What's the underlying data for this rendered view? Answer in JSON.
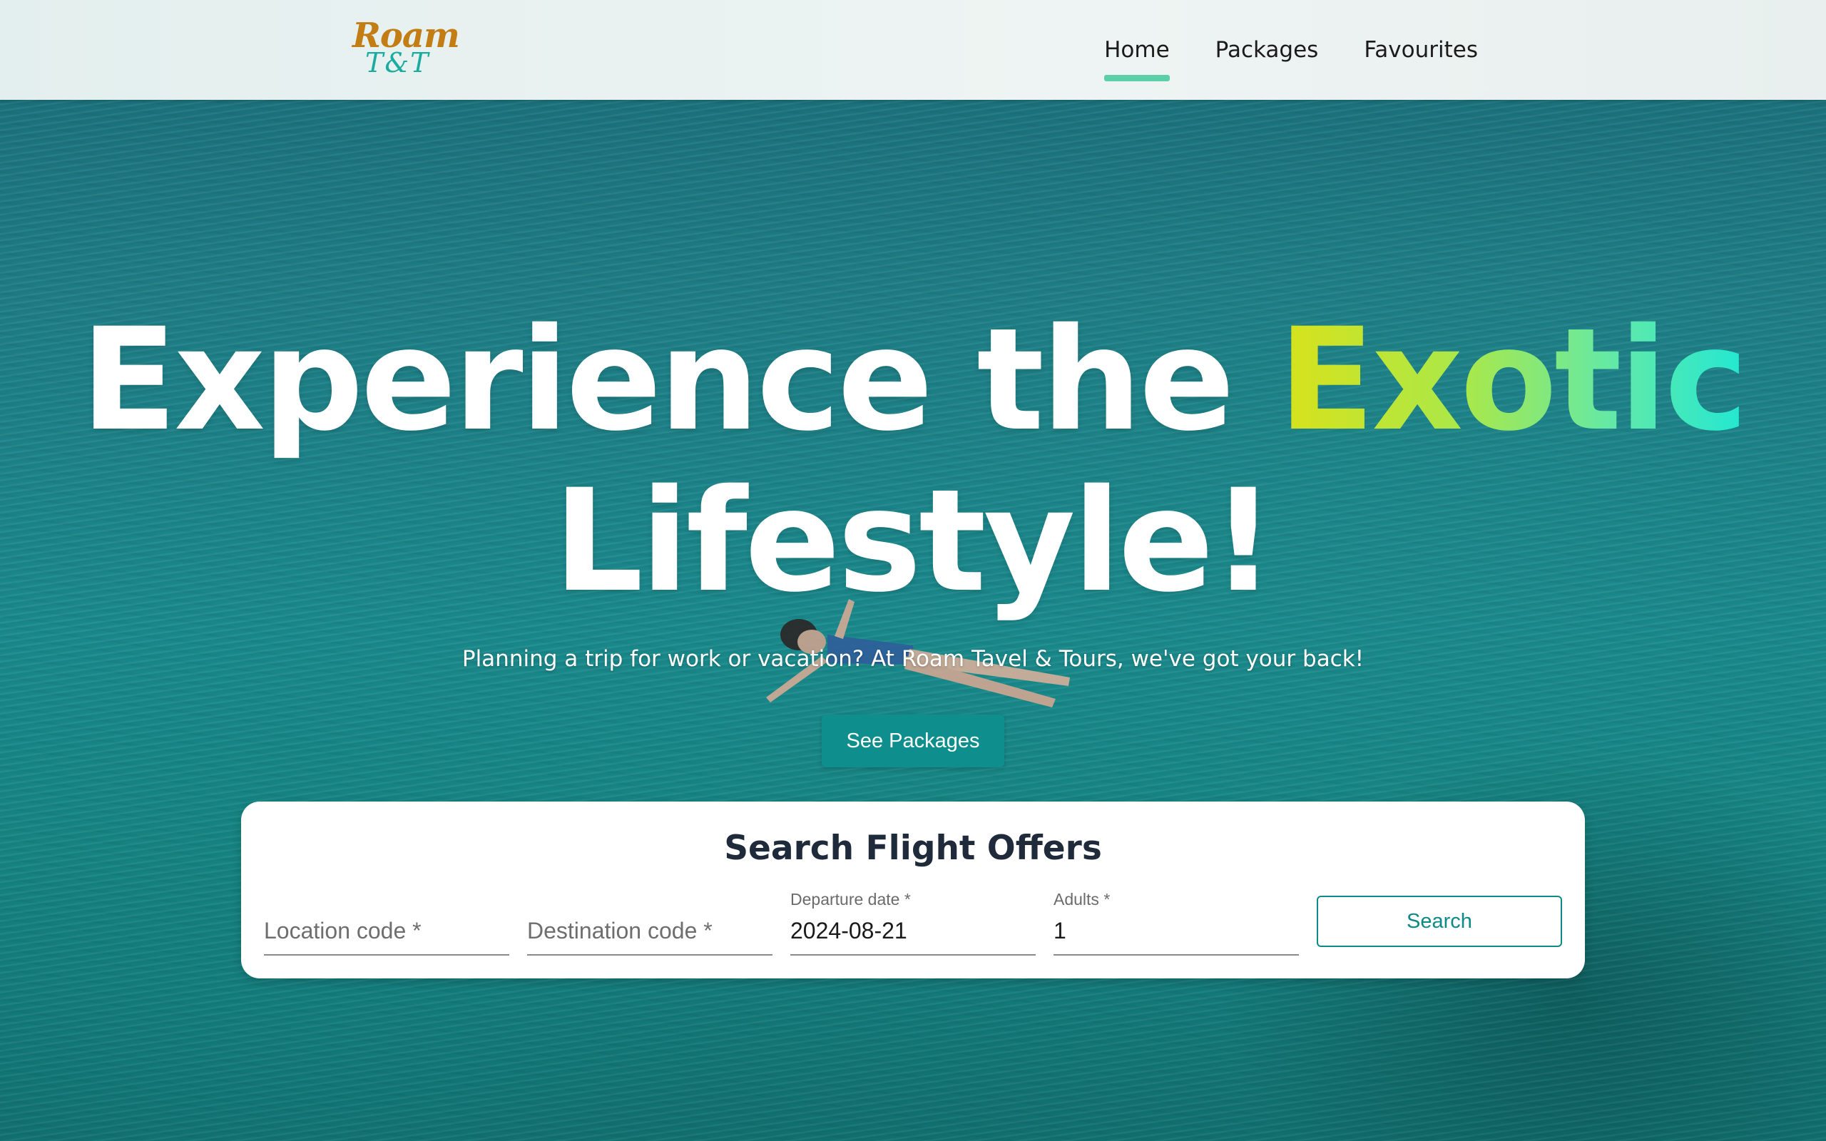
{
  "colors": {
    "accent": "#0e8e8c",
    "nav_underline": "#5ccfa9",
    "logo_primary": "#c27d15",
    "logo_secondary": "#1bab9f",
    "card_title": "#1f2b3a"
  },
  "logo": {
    "line1": "Roam",
    "line2": "T&T"
  },
  "nav": {
    "items": [
      {
        "label": "Home",
        "active": true
      },
      {
        "label": "Packages",
        "active": false
      },
      {
        "label": "Favourites",
        "active": false
      }
    ]
  },
  "hero": {
    "title_part1": "Experience the ",
    "title_highlight": "Exotic",
    "title_part2": "Lifestyle!",
    "subtitle": "Planning a trip for work or vacation? At Roam Tavel & Tours, we've got your back!",
    "cta_label": "See Packages"
  },
  "search": {
    "title": "Search Flight Offers",
    "fields": [
      {
        "label": "",
        "placeholder": "Location code *",
        "value": ""
      },
      {
        "label": "",
        "placeholder": "Destination code *",
        "value": ""
      },
      {
        "label": "Departure date *",
        "placeholder": "",
        "value": "2024-08-21"
      },
      {
        "label": "Adults *",
        "placeholder": "",
        "value": "1"
      }
    ],
    "button_label": "Search"
  }
}
